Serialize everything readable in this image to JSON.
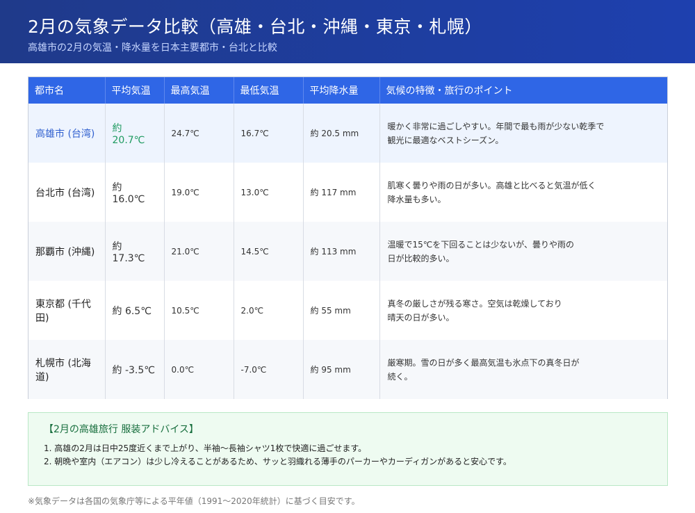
{
  "header": {
    "title": "2月の気象データ比較（高雄・台北・沖縄・東京・札幌）",
    "subtitle": "高雄市の2月の気温・降水量を日本主要都市・台北と比較"
  },
  "table": {
    "columns": [
      "都市名",
      "平均気温",
      "最高気温",
      "最低気温",
      "平均降水量",
      "気候の特徴・旅行のポイント"
    ],
    "rows": [
      {
        "city": "高雄市 (台湾)",
        "avg": "約 20.7℃",
        "max": "24.7℃",
        "min": "16.7℃",
        "rain": "約 20.5 mm",
        "note": "暖かく非常に過ごしやすい。年間で最も雨が少ない乾季で\n観光に最適なベストシーズン。"
      },
      {
        "city": "台北市 (台湾)",
        "avg": "約 16.0℃",
        "max": "19.0℃",
        "min": "13.0℃",
        "rain": "約 117 mm",
        "note": "肌寒く曇りや雨の日が多い。高雄と比べると気温が低く\n降水量も多い。"
      },
      {
        "city": "那覇市 (沖縄)",
        "avg": "約 17.3℃",
        "max": "21.0℃",
        "min": "14.5℃",
        "rain": "約 113 mm",
        "note": "温暖で15℃を下回ることは少ないが、曇りや雨の\n日が比較的多い。"
      },
      {
        "city": "東京都 (千代田)",
        "avg": "約 6.5℃",
        "max": "10.5℃",
        "min": "2.0℃",
        "rain": "約 55 mm",
        "note": "真冬の厳しさが残る寒さ。空気は乾燥しており\n晴天の日が多い。"
      },
      {
        "city": "札幌市 (北海道)",
        "avg": "約 -3.5℃",
        "max": "0.0℃",
        "min": "-7.0℃",
        "rain": "約 95 mm",
        "note": "厳寒期。雪の日が多く最高気温も氷点下の真冬日が\n続く。"
      }
    ]
  },
  "advice": {
    "title": "【2月の高雄旅行 服装アドバイス】",
    "items": [
      "1. 高雄の2月は日中25度近くまで上がり、半袖〜長袖シャツ1枚で快適に過ごせます。",
      "2. 朝晩や室内（エアコン）は少し冷えることがあるため、サッと羽織れる薄手のパーカーやカーディガンがあると安心です。"
    ]
  },
  "footnote": "※気象データは各国の気象庁等による平年値（1991〜2020年統計）に基づく目安です。"
}
